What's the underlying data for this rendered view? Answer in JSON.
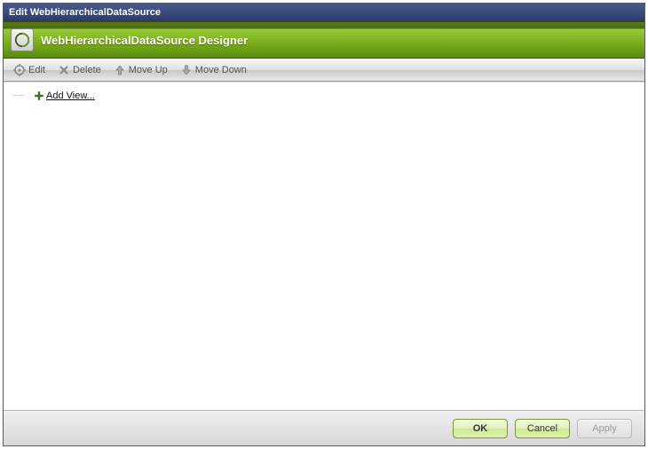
{
  "window": {
    "title": "Edit WebHierarchicalDataSource"
  },
  "designer": {
    "title": "WebHierarchicalDataSource Designer"
  },
  "toolbar": {
    "edit": "Edit",
    "delete": "Delete",
    "moveUp": "Move Up",
    "moveDown": "Move Down"
  },
  "tree": {
    "addView": "Add View..."
  },
  "buttons": {
    "ok": "OK",
    "cancel": "Cancel",
    "apply": "Apply"
  }
}
